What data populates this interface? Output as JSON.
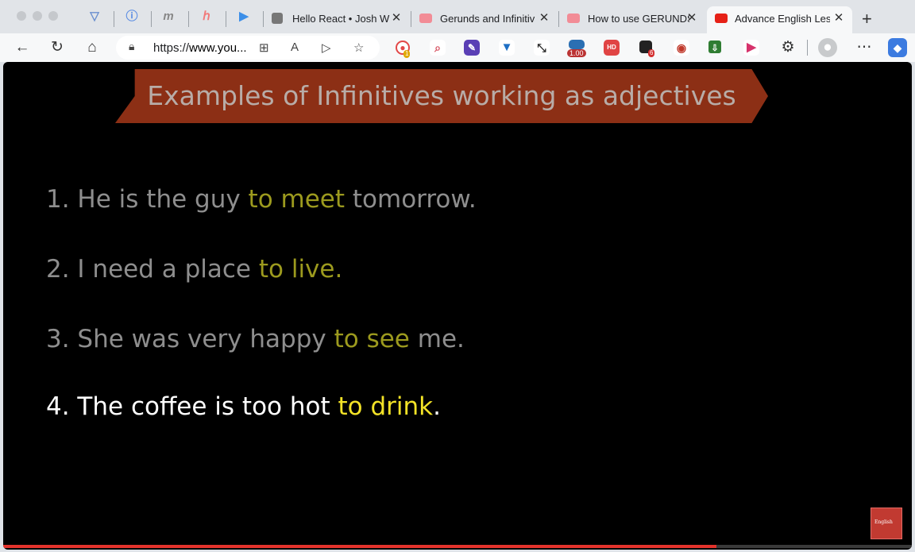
{
  "browser": {
    "pinned_tabs": [
      {
        "icon": "vuetify-icon",
        "glyph": "V",
        "color": "#6a8fcf"
      },
      {
        "icon": "info-icon",
        "glyph": "i",
        "color": "#5b8de3"
      },
      {
        "icon": "medium-icon",
        "glyph": "m",
        "color": "#888888"
      },
      {
        "icon": "hotjar-icon",
        "glyph": "hj",
        "color": "#f27a7a"
      },
      {
        "icon": "bing-icon",
        "glyph": "b",
        "color": "#3c8fe8"
      }
    ],
    "tabs": [
      {
        "label": "Hello React • Josh W",
        "icon": "external-link-icon",
        "icon_color": "#777777",
        "active": false
      },
      {
        "label": "Gerunds and Infinitiv",
        "icon": "youtube-icon",
        "icon_color": "#f28c96",
        "active": false
      },
      {
        "label": "How to use GERUNDS",
        "icon": "youtube-icon",
        "icon_color": "#f28c96",
        "active": false
      },
      {
        "label": "Advance English Less",
        "icon": "youtube-icon",
        "icon_color": "#e62117",
        "active": true
      }
    ],
    "url_prefix": "https://",
    "url_host": "www.you...",
    "extensions": [
      {
        "name": "record-extension-icon",
        "badge": "1",
        "color": "#e24848"
      },
      {
        "name": "search-extension-icon",
        "badge": "",
        "color": "#d64f5e"
      },
      {
        "name": "edit-extension-icon",
        "badge": "",
        "color": "#5a3fb5"
      },
      {
        "name": "vuetify-extension-icon",
        "badge": "",
        "color": "#1e6fc4"
      },
      {
        "name": "arrows-extension-icon",
        "badge": "",
        "color": "#222222"
      },
      {
        "name": "speed-extension-icon",
        "badge": "1.00",
        "color": "#2b6fb3"
      },
      {
        "name": "hd-extension-icon",
        "badge": "",
        "color": "#e04444"
      },
      {
        "name": "ublock-extension-icon",
        "badge": "6",
        "color": "#222222"
      },
      {
        "name": "screen-extension-icon",
        "badge": "",
        "color": "#c0392b"
      },
      {
        "name": "download-extension-icon",
        "badge": "",
        "color": "#2f7d32"
      },
      {
        "name": "play-extension-icon",
        "badge": "",
        "color": "#d6336c"
      }
    ]
  },
  "video": {
    "banner_title": "Examples of Infinitives working as adjectives",
    "lines": [
      {
        "pre": "1. He is the guy ",
        "hl": "to meet",
        "post": " tomorrow.",
        "current": false
      },
      {
        "pre": "2. I need a place ",
        "hl": "to live.",
        "post": "",
        "current": false
      },
      {
        "pre": "3. She was very happy ",
        "hl": "to see",
        "post": " me.",
        "current": false
      },
      {
        "pre": "4. The coffee is too hot ",
        "hl": "to drink",
        "post": ".",
        "current": true
      }
    ],
    "logo_text": "English",
    "progress": 0.785
  }
}
